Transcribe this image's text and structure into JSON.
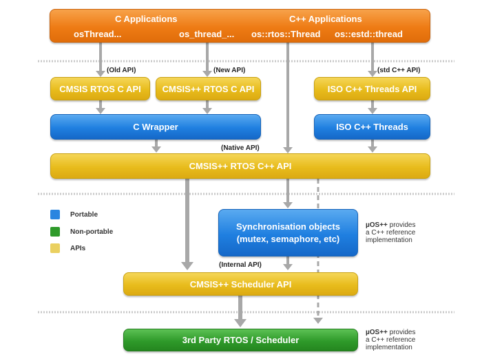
{
  "applications": {
    "c_title": "C Applications",
    "cpp_title": "C++ Applications",
    "items": [
      "osThread...",
      "os_thread_...",
      "os::rtos::Thread",
      "os::estd::thread"
    ]
  },
  "api_labels": {
    "old": "(Old API)",
    "new": "(New API)",
    "std": "(std C++ API)",
    "native": "(Native API)",
    "internal": "(Internal API)"
  },
  "boxes": {
    "cmsis_rtos_c": "CMSIS RTOS C API",
    "cmsispp_rtos_c": "CMSIS++ RTOS C API",
    "iso_cpp_threads_api": "ISO C++ Threads API",
    "c_wrapper": "C Wrapper",
    "iso_cpp_threads": "ISO C++ Threads",
    "cmsispp_rtos_cpp": "CMSIS++ RTOS C++ API",
    "sync_line1": "Synchronisation objects",
    "sync_line2": "(mutex, semaphore, etc)",
    "scheduler_api": "CMSIS++ Scheduler API",
    "third_party": "3rd Party RTOS / Scheduler"
  },
  "legend": [
    {
      "label": "Portable",
      "color": "#2a85e0"
    },
    {
      "label": "Non-portable",
      "color": "#2e9a2a"
    },
    {
      "label": "APIs",
      "color": "#ead060"
    }
  ],
  "notes": {
    "brand": "µOS++",
    "line1_rest": " provides",
    "line2": "a C++ reference",
    "line3": "implementation"
  },
  "colors": {
    "orange": "#ee7b14",
    "yellow": "#e8bc1c",
    "blue": "#1f7fe0",
    "green": "#2f9a2a",
    "arrow": "#a8a8a8"
  }
}
